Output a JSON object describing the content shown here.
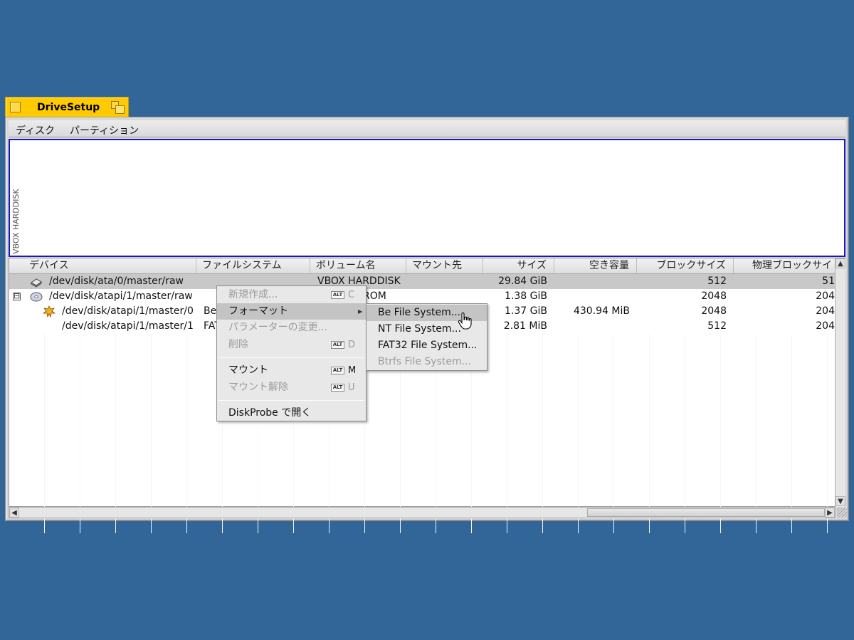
{
  "window": {
    "title": "DriveSetup"
  },
  "menubar": {
    "disk": "ディスク",
    "partition": "パーティション"
  },
  "diskmap": {
    "label": "VBOX HARDDISK"
  },
  "columns": {
    "device": "デバイス",
    "filesystem": "ファイルシステム",
    "volume": "ボリューム名",
    "mount": "マウント先",
    "size": "サイズ",
    "free": "空き容量",
    "block": "ブロックサイズ",
    "physical": "物理ブロックサイ"
  },
  "rows": [
    {
      "device": "/dev/disk/ata/0/master/raw",
      "filesystem": "",
      "volume": "VBOX HARDDISK",
      "size": "29.84 GiB",
      "free": "",
      "block": "512",
      "physical": "51"
    },
    {
      "device": "/dev/disk/atapi/1/master/raw",
      "filesystem": "",
      "volume": "ROM",
      "size": "1.38 GiB",
      "free": "",
      "block": "2048",
      "physical": "204"
    },
    {
      "device": "/dev/disk/atapi/1/master/0",
      "filesystem": "Be",
      "volume": "",
      "size": "1.37 GiB",
      "free": "430.94 MiB",
      "block": "2048",
      "physical": "204"
    },
    {
      "device": "/dev/disk/atapi/1/master/1",
      "filesystem": "FAT",
      "volume": "",
      "size": "2.81 MiB",
      "free": "",
      "block": "512",
      "physical": "204"
    }
  ],
  "expander": "⊟",
  "context_menu": {
    "new": "新規作成...",
    "new_key": "C",
    "format": "フォーマット",
    "change_params": "パラメーターの変更...",
    "delete": "削除",
    "delete_key": "D",
    "mount": "マウント",
    "mount_key": "M",
    "unmount": "マウント解除",
    "unmount_key": "U",
    "open_diskprobe": "DiskProbe で開く",
    "alt_label": "ALT"
  },
  "format_submenu": {
    "bfs": "Be File System...",
    "ntfs": "NT File System...",
    "fat32": "FAT32 File System...",
    "btrfs": "Btrfs File System..."
  },
  "scroll": {
    "up": "▲",
    "down": "▼",
    "left": "◀",
    "right": "▶"
  },
  "submenu_arrow": "▶"
}
